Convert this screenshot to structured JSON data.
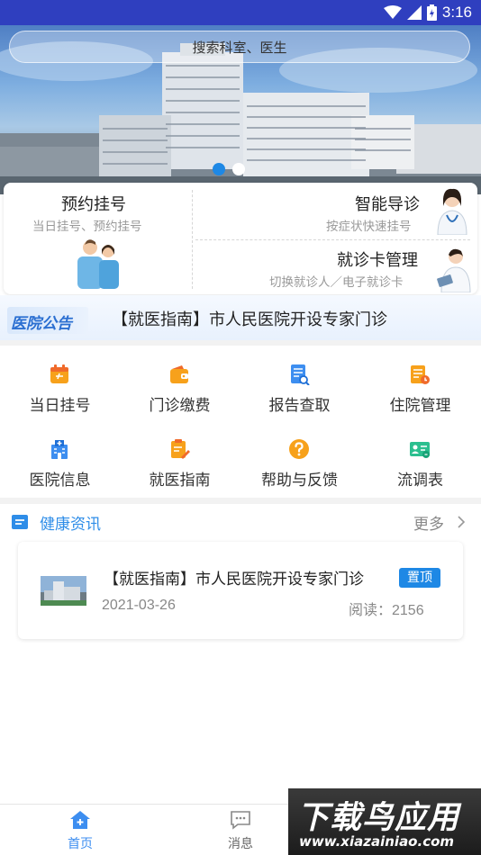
{
  "status_bar": {
    "time": "3:16"
  },
  "search": {
    "placeholder": "搜索科室、医生"
  },
  "banner": {
    "slide_count": 2,
    "active_slide": 1
  },
  "features": {
    "appointment": {
      "title": "预约挂号",
      "subtitle": "当日挂号、预约挂号"
    },
    "smart_triage": {
      "title": "智能导诊",
      "subtitle": "按症状快速挂号"
    },
    "card_manage": {
      "title": "就诊卡管理",
      "subtitle": "切换就诊人／电子就诊卡"
    }
  },
  "notice": {
    "logo_text": "医院公告",
    "text": "【就医指南】市人民医院开设专家门诊"
  },
  "menu": [
    {
      "label": "当日挂号",
      "icon": "calendar-today-icon"
    },
    {
      "label": "门诊缴费",
      "icon": "wallet-icon"
    },
    {
      "label": "报告查取",
      "icon": "report-search-icon"
    },
    {
      "label": "住院管理",
      "icon": "inpatient-icon"
    },
    {
      "label": "医院信息",
      "icon": "hospital-building-icon"
    },
    {
      "label": "就医指南",
      "icon": "guide-icon"
    },
    {
      "label": "帮助与反馈",
      "icon": "help-icon"
    },
    {
      "label": "流调表",
      "icon": "id-card-icon"
    }
  ],
  "news": {
    "section_title": "健康资讯",
    "more_label": "更多",
    "items": [
      {
        "title": "【就医指南】市人民医院开设专家门诊",
        "badge": "置顶",
        "date": "2021-03-26",
        "views": "阅读：2156"
      }
    ]
  },
  "bottom_nav": [
    {
      "label": "首页",
      "icon": "home-icon",
      "active": true
    },
    {
      "label": "消息",
      "icon": "message-icon",
      "active": false
    }
  ],
  "watermark": {
    "big": "下载鸟应用",
    "small": "www.xiazainiao.com"
  },
  "colors": {
    "status_bar": "#2f3fbf",
    "accent": "#1e88e5",
    "news_title": "#2e8de8",
    "menu_orange": "#f7a11b"
  }
}
